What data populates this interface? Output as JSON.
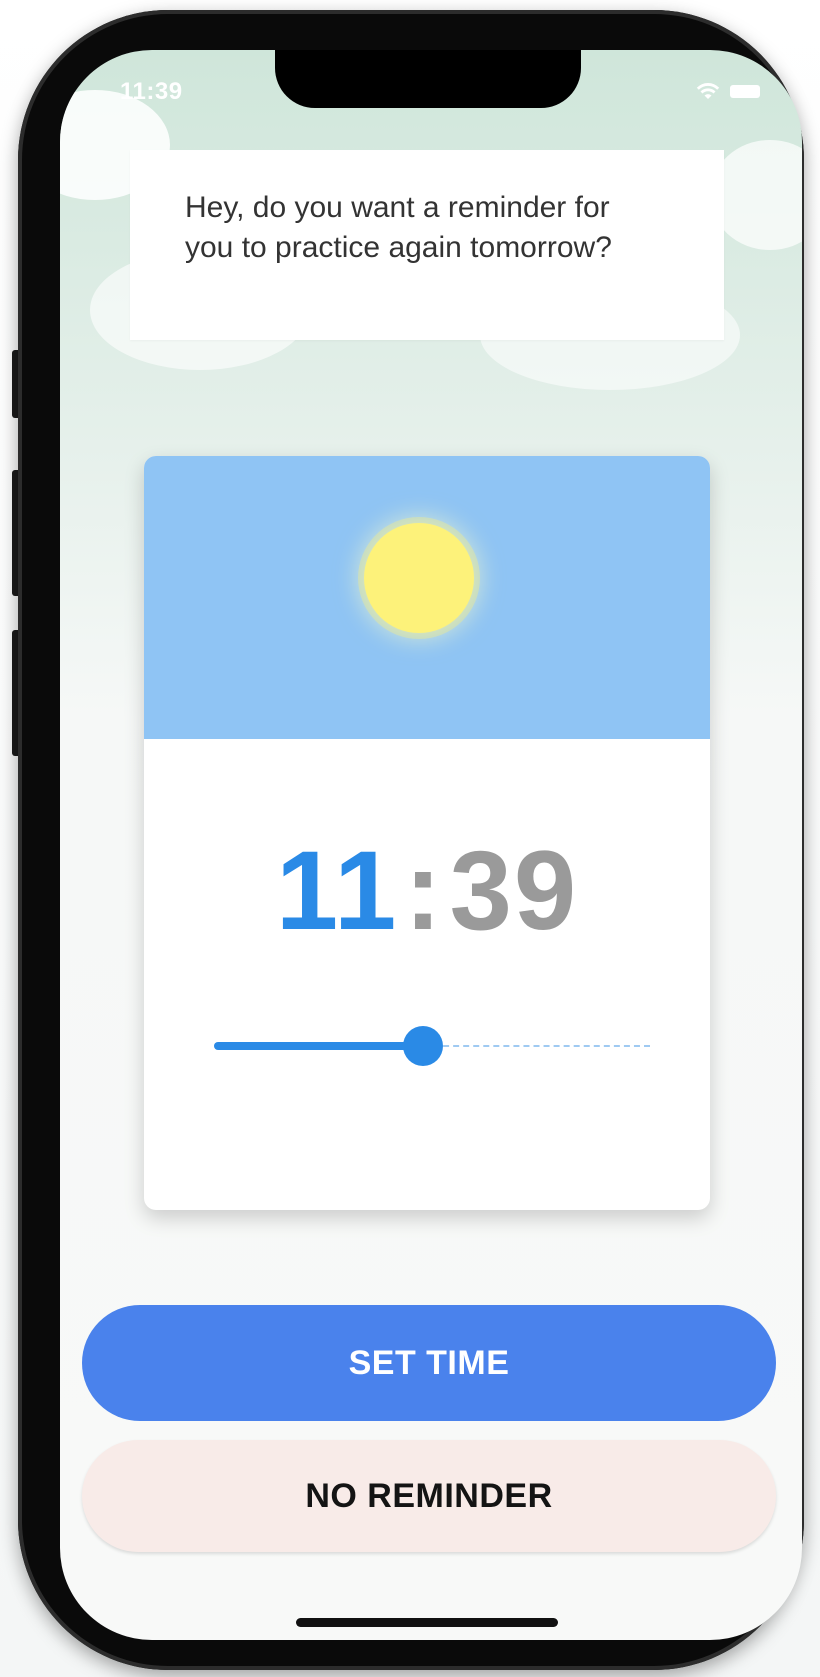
{
  "status_bar": {
    "time": "11:39",
    "icons": [
      "wifi-icon",
      "battery-icon"
    ]
  },
  "prompt": {
    "text": "Hey, do you want a reminder for you to practice again tomorrow?"
  },
  "time_picker": {
    "hours": "11",
    "separator": ":",
    "minutes": "39",
    "slider_value_fraction": 0.48,
    "illustration": "sun-icon"
  },
  "buttons": {
    "set_time_label": "SET TIME",
    "no_reminder_label": "NO REMINDER"
  },
  "colors": {
    "primary_button": "#4a82ec",
    "secondary_button": "#f8ebe8",
    "hour_accent": "#2a8ae6",
    "minutes_gray": "#9a9a9a",
    "sky": "#8fc4f4",
    "sun": "#fdf27a"
  }
}
